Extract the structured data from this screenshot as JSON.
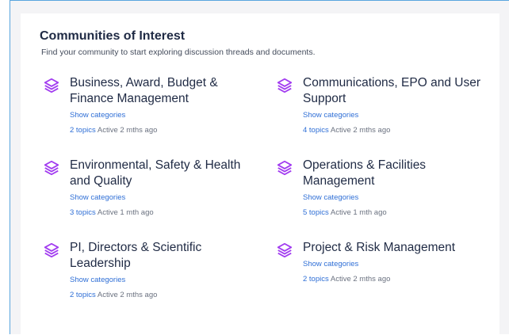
{
  "header": {
    "title": "Communities of Interest",
    "subtitle": "Find your community to start exploring discussion threads and documents."
  },
  "colors": {
    "icon": "#a23cf0",
    "link": "#2f6fd6",
    "frame_border": "#5aa6de"
  },
  "communities": [
    {
      "name": "Business, Award, Budget & Finance Management",
      "show_label": "Show categories",
      "topics": "2 topics",
      "active": "Active 2 mths ago",
      "icon": "layers-icon"
    },
    {
      "name": "Communications, EPO and User Support",
      "show_label": "Show categories",
      "topics": "4 topics",
      "active": "Active 2 mths ago",
      "icon": "layers-icon"
    },
    {
      "name": "Environmental, Safety & Health and Quality",
      "show_label": "Show categories",
      "topics": "3 topics",
      "active": "Active 1 mth ago",
      "icon": "layers-icon"
    },
    {
      "name": "Operations & Facilities Management",
      "show_label": "Show categories",
      "topics": "5 topics",
      "active": "Active 1 mth ago",
      "icon": "layers-icon"
    },
    {
      "name": "PI, Directors & Scientific Leadership",
      "show_label": "Show categories",
      "topics": "2 topics",
      "active": "Active 2 mths ago",
      "icon": "layers-icon"
    },
    {
      "name": "Project & Risk Management",
      "show_label": "Show categories",
      "topics": "2 topics",
      "active": "Active 2 mths ago",
      "icon": "layers-icon"
    }
  ]
}
